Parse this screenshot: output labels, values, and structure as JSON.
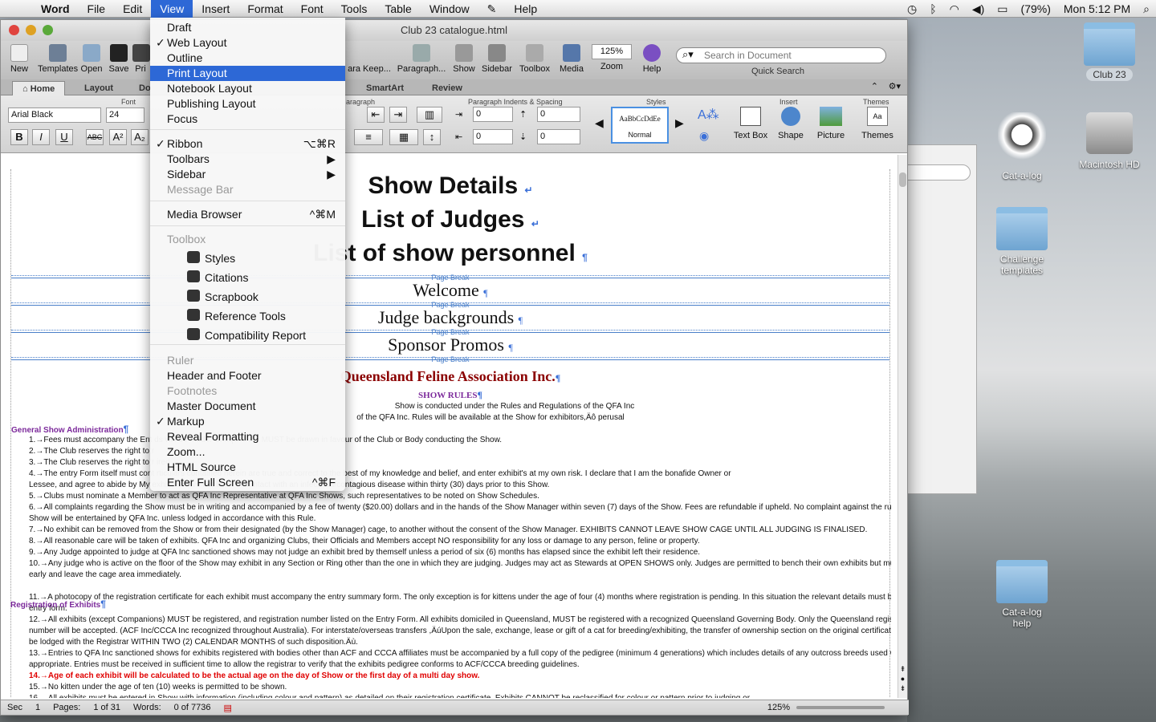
{
  "menubar": {
    "app": "Word",
    "items": [
      "File",
      "Edit",
      "View",
      "Insert",
      "Format",
      "Font",
      "Tools",
      "Table",
      "Window",
      "Help"
    ],
    "battery": "(79%)",
    "clock": "Mon 5:12 PM"
  },
  "window": {
    "title": "Club 23 catalogue.html"
  },
  "toolbar": {
    "buttons": [
      "New",
      "Templates",
      "Open",
      "Save",
      "Pri",
      "ara Keep...",
      "Paragraph...",
      "Show",
      "Sidebar",
      "Toolbox",
      "Media",
      "Zoom",
      "Help"
    ],
    "zoom": "125%",
    "search_placeholder": "Search in Document",
    "quick_search": "Quick Search"
  },
  "tabs": [
    "Home",
    "Layout",
    "Do",
    "SmartArt",
    "Review"
  ],
  "ribbon": {
    "font_label": "Font",
    "font_name": "Arial Black",
    "font_size": "24",
    "paragraph_label": "aragraph",
    "indents_label": "Paragraph Indents & Spacing",
    "indent_values": [
      "0",
      "0",
      "0",
      "0"
    ],
    "styles_label": "Styles",
    "style_sample": "AaBbCcDdEe",
    "style_name": "Normal",
    "insert_label": "Insert",
    "themes_label": "Themes",
    "insert_buttons": [
      "Text Box",
      "Shape",
      "Picture"
    ],
    "themes_button": "Themes"
  },
  "view_menu": {
    "items": [
      {
        "label": "Draft",
        "check": ""
      },
      {
        "label": "Web Layout",
        "check": "✓"
      },
      {
        "label": "Outline",
        "check": ""
      },
      {
        "label": "Print Layout",
        "check": "",
        "highlight": true
      },
      {
        "label": "Notebook Layout",
        "check": ""
      },
      {
        "label": "Publishing Layout",
        "check": ""
      },
      {
        "label": "Focus",
        "check": ""
      },
      {
        "label": "Ribbon",
        "check": "✓",
        "shortcut": "⌥⌘R"
      },
      {
        "label": "Toolbars",
        "check": "",
        "shortcut": "▶"
      },
      {
        "label": "Sidebar",
        "check": "",
        "shortcut": "▶"
      },
      {
        "label": "Message Bar",
        "check": "",
        "disabled": true
      },
      {
        "label": "Media Browser",
        "check": "",
        "shortcut": "^⌘M"
      },
      {
        "label": "Toolbox",
        "check": "",
        "disabled": true
      },
      {
        "label": "Styles",
        "sub": true
      },
      {
        "label": "Citations",
        "sub": true
      },
      {
        "label": "Scrapbook",
        "sub": true
      },
      {
        "label": "Reference Tools",
        "sub": true
      },
      {
        "label": "Compatibility Report",
        "sub": true
      },
      {
        "label": "Ruler",
        "check": "",
        "disabled": true
      },
      {
        "label": "Header and Footer",
        "check": ""
      },
      {
        "label": "Footnotes",
        "check": "",
        "disabled": true
      },
      {
        "label": "Master Document",
        "check": ""
      },
      {
        "label": "Markup",
        "check": "✓"
      },
      {
        "label": "Reveal Formatting",
        "check": ""
      },
      {
        "label": "Zoom...",
        "check": ""
      },
      {
        "label": "HTML Source",
        "check": ""
      },
      {
        "label": "Enter Full Screen",
        "check": "",
        "shortcut": "^⌘F"
      }
    ]
  },
  "document": {
    "headings": [
      "Show Details",
      "List of Judges",
      "List of show personnel"
    ],
    "sections": [
      "Welcome",
      "Judge backgrounds",
      "Sponsor Promos"
    ],
    "page_break": "Page Break",
    "assoc": "Queensland Feline Association Inc.",
    "show_rules": "SHOW RULES",
    "intro1": "Show is conducted under the Rules and Regulations of the QFA Inc",
    "intro2": "of the QFA Inc. Rules will be available at the Show for exhibitors,Äô perusal",
    "sec1": "General Show Administration",
    "sec2": "Registration of Exhibits",
    "rules": [
      "1.→Fees must accompany the Ent                                                   ds will be made.  Cheques etc MUST be drawn in favour of the Club or Body conducting the Show.",
      "2.→The Club reserves the right to r",
      "3.→The Club reserves the right to r                                                        ired.",
      "4.→The entry Form itself must cont                                         rticulars contained herein are true and correct to the best of my knowledge and belief, and enter exhibit's at my own risk.  I declare that I am the bonafide Owner or",
      "      Lessee, and agree to abide by                                                            My exhibit's have not been in contact with an infectious/contagious disease within thirty (30) days prior to this Show.",
      "5.→Clubs must nominate a Member                                    to act as QFA Inc Representative at QFA Inc Shows, such representatives to be noted on Show Schedules.",
      "6.→All complaints regarding the Show must be in writing and accompanied by a fee of twenty ($20.00) dollars and in the hands of the Show Manager within seven (7) days of the Show.  Fees are refundable if upheld.  No complaint against the running of the",
      "      Show will be entertained by QFA Inc. unless lodged in accordance with this Rule.",
      "7.→No exhibit can be removed from the Show or from their designated (by the Show Manager) cage, to another without the consent of the Show Manager.  EXHIBITS CANNOT LEAVE SHOW CAGE UNTIL ALL JUDGING IS FINALISED.",
      "8.→All reasonable care will be taken of exhibits.  QFA Inc and organizing Clubs, their Officials and Members accept NO responsibility for any loss or damage to any person, feline or property.",
      "9.→Any Judge appointed to judge at QFA Inc sanctioned shows may not judge an exhibit bred by themself unless a period of six (6) months has elapsed since the exhibit left their residence.",
      "10.→Any judge who is active on the floor of the Show may exhibit in any Section or Ring other than the one in which they are judging.  Judges may act as Stewards at OPEN SHOWS only.  Judges are permitted to bench their own exhibits but must bench",
      "      early and leave the cage area immediately.",
      "11.→A photocopy of the registration certificate for each exhibit must accompany the entry summary form.  The only exception is for kittens under the age of four (4) months where registration is pending. In this situation the relevant details must be filled in on the",
      "      entry form.",
      "12.→All exhibits (except Companions) MUST be registered, and registration number listed on the Entry Form.  All exhibits domiciled in Queensland, MUST be registered with a recognized Queensland Governing Body.  Only the Queensland registration",
      "      number will be accepted.  (ACF Inc/CCCA Inc recognized throughout Australia).  For interstate/overseas transfers ,ÄúUpon the sale, exchange, lease or gift of a cat for breeding/exhibiting, the transfer of ownership section on the original certificate must",
      "      be lodged with the Registrar WITHIN TWO (2) CALENDAR MONTHS of such disposition.Äù.",
      "13.→Entries to QFA Inc sanctioned shows for exhibits registered with bodies other than ACF and CCCA affiliates must be accompanied by a full copy of the pedigree (minimum 4 generations) which includes details of any outcross breeds used where",
      "      appropriate.  Entries must be received in sufficient time to allow the registrar to verify that the exhibits pedigree conforms to ACF/CCCA breeding guidelines.",
      "14.→Age of each exhibit will be calculated to be the actual age on the day of Show or the first day of a multi day show.",
      "15.→No kitten under the age of ten (10) weeks is permitted to be shown.",
      "16.→All exhibits must be entered in Show with information (including colour and pattern) as detailed on their registration certificate.  Exhibits CANNOT be reclassified for colour or pattern prior to judging or"
    ]
  },
  "status": {
    "sec": "Sec",
    "sec_val": "1",
    "pages": "Pages:",
    "pages_val": "1 of 31",
    "words": "Words:",
    "words_val": "0 of 7736",
    "zoom": "125%"
  },
  "desktop": {
    "icons": [
      "Club 23",
      "Cat-a-log",
      "Macintosh HD",
      "Challenge templates",
      "Cat-a-log help"
    ]
  },
  "colors": {
    "accent": "#2d68d6",
    "assoc": "#8b0000",
    "section": "#7c2a9b",
    "rule14": "#e00000"
  }
}
